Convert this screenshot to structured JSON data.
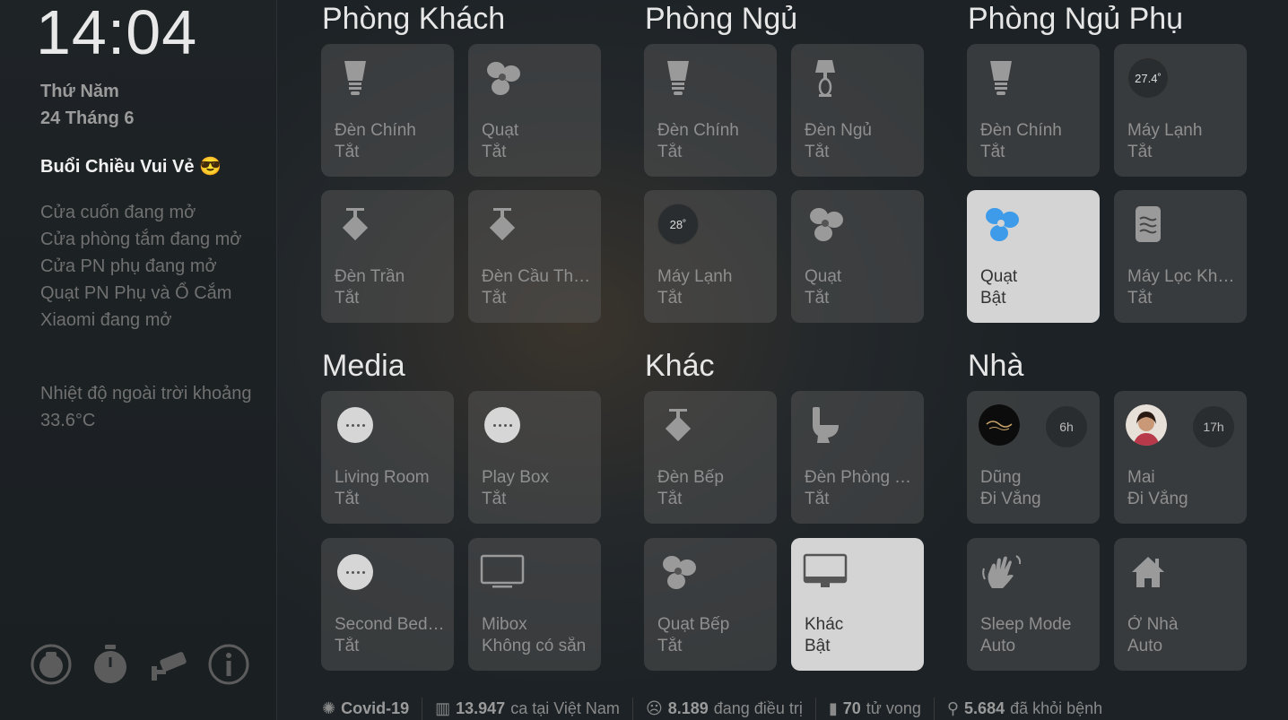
{
  "sidebar": {
    "time": "14:04",
    "day": "Thứ Năm",
    "date": "24 Tháng 6",
    "greeting": "Buổi Chiều Vui Vẻ",
    "greeting_emoji": "😎",
    "notices": [
      "Cửa cuốn đang mở",
      "Cửa phòng tắm đang mở",
      "Cửa PN phụ đang mở",
      "Quạt PN Phụ và Ổ Cắm Xiaomi đang mở"
    ],
    "weather": "Nhiệt độ ngoài trời khoảng 33.6°C",
    "bottom_icons": [
      "vacuum-robot-icon",
      "stopwatch-icon",
      "security-camera-icon",
      "info-icon"
    ]
  },
  "sections": [
    {
      "title": "Phòng Khách",
      "tiles": [
        {
          "name": "Đèn Chính",
          "state": "Tắt",
          "icon": "bulb-icon",
          "on": false
        },
        {
          "name": "Quạt",
          "state": "Tắt",
          "icon": "fan-icon",
          "on": false
        },
        {
          "name": "Đèn Trần",
          "state": "Tắt",
          "icon": "ceiling-light-icon",
          "on": false
        },
        {
          "name": "Đèn Cầu Thang",
          "state": "Tắt",
          "icon": "ceiling-light-icon",
          "on": false
        }
      ]
    },
    {
      "title": "Phòng Ngủ",
      "tiles": [
        {
          "name": "Đèn Chính",
          "state": "Tắt",
          "icon": "bulb-icon",
          "on": false
        },
        {
          "name": "Đèn Ngủ",
          "state": "Tắt",
          "icon": "lamp-icon",
          "on": false
        },
        {
          "name": "Máy Lạnh",
          "state": "Tắt",
          "icon": "thermostat-icon",
          "badge": "28˚",
          "on": false
        },
        {
          "name": "Quạt",
          "state": "Tắt",
          "icon": "fan-icon",
          "on": false
        }
      ]
    },
    {
      "title": "Phòng Ngủ Phụ",
      "tiles": [
        {
          "name": "Đèn Chính",
          "state": "Tắt",
          "icon": "bulb-icon",
          "on": false
        },
        {
          "name": "Máy Lạnh",
          "state": "Tắt",
          "icon": "thermostat-icon",
          "badge": "27.4˚",
          "on": false
        },
        {
          "name": "Quạt",
          "state": "Bật",
          "icon": "fan-icon",
          "on": true
        },
        {
          "name": "Máy Lọc Không Khí",
          "state": "Tắt",
          "icon": "air-purifier-icon",
          "on": false
        }
      ]
    },
    {
      "title": "Media",
      "tiles": [
        {
          "name": "Living Room",
          "state": "Tắt",
          "icon": "more-dots-icon",
          "on": false
        },
        {
          "name": "Play Box",
          "state": "Tắt",
          "icon": "more-dots-icon",
          "on": false
        },
        {
          "name": "Second Bedroom",
          "state": "Tắt",
          "icon": "more-dots-icon",
          "on": false
        },
        {
          "name": "Mibox",
          "state": "Không có sẵn",
          "icon": "tv-icon",
          "on": false
        }
      ]
    },
    {
      "title": "Khác",
      "tiles": [
        {
          "name": "Đèn Bếp",
          "state": "Tắt",
          "icon": "ceiling-light-icon",
          "on": false
        },
        {
          "name": "Đèn Phòng Tắm",
          "state": "Tắt",
          "icon": "toilet-icon",
          "on": false
        },
        {
          "name": "Quạt Bếp",
          "state": "Tắt",
          "icon": "fan-icon",
          "on": false
        },
        {
          "name": "Khác",
          "state": "Bật",
          "icon": "monitor-icon",
          "on": true
        }
      ]
    },
    {
      "title": "Nhà",
      "tiles": [
        {
          "name": "Dũng",
          "state": "Đi Vắng",
          "icon": "avatar-dung",
          "hours": "6h",
          "on": false
        },
        {
          "name": "Mai",
          "state": "Đi Vắng",
          "icon": "avatar-mai",
          "hours": "17h",
          "on": false
        },
        {
          "name": "Sleep Mode",
          "state": "Auto",
          "icon": "wave-hand-icon",
          "on": false
        },
        {
          "name": "Ở Nhà",
          "state": "Auto",
          "icon": "home-icon",
          "on": false
        }
      ]
    }
  ],
  "footer": {
    "covid_label": "Covid-19",
    "cases": "13.947",
    "cases_label": "ca tại Việt Nam",
    "treating": "8.189",
    "treating_label": "đang điều trị",
    "deaths": "70",
    "deaths_label": "tử vong",
    "recovered": "5.684",
    "recovered_label": "đã khỏi bệnh"
  },
  "colors": {
    "fan_on": "#3d9be9",
    "tile_off": "#5a5a5a",
    "tile_on": "#d4d4d4"
  }
}
